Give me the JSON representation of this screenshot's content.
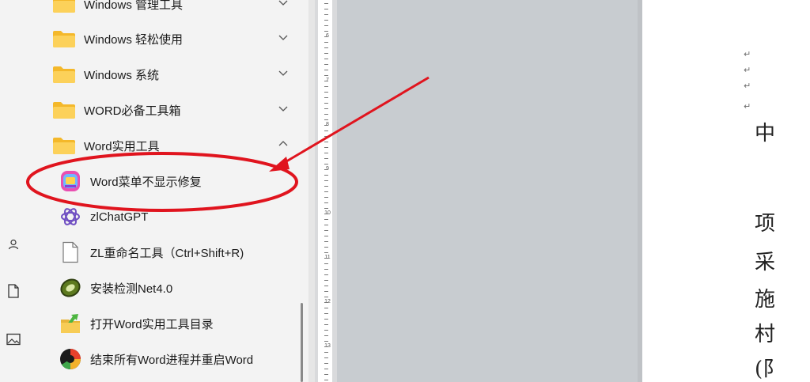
{
  "start_menu": {
    "items": [
      {
        "label": "Windows 管理工具",
        "type": "folder",
        "expanded": false
      },
      {
        "label": "Windows 轻松使用",
        "type": "folder",
        "expanded": false
      },
      {
        "label": "Windows 系统",
        "type": "folder",
        "expanded": false
      },
      {
        "label": "WORD必备工具箱",
        "type": "folder",
        "expanded": false
      },
      {
        "label": "Word实用工具",
        "type": "folder",
        "expanded": true
      }
    ],
    "sub_items": [
      {
        "label": "Word菜单不显示修复",
        "icon": "repair-app-icon"
      },
      {
        "label": "zlChatGPT",
        "icon": "chatgpt-icon"
      },
      {
        "label": "ZL重命名工具（Ctrl+Shift+R)",
        "icon": "blank-document-icon"
      },
      {
        "label": "安装检测Net4.0",
        "icon": "net-install-icon"
      },
      {
        "label": "打开Word实用工具目录",
        "icon": "folder-arrow-icon"
      },
      {
        "label": "结束所有Word进程并重启Word",
        "icon": "restart-word-icon"
      }
    ],
    "rail_icons": [
      "user-icon",
      "document-icon",
      "pictures-icon"
    ]
  },
  "ruler": {
    "numbers": [
      "6",
      "7",
      "8",
      "9",
      "10",
      "11",
      "12",
      "13"
    ]
  },
  "document": {
    "chars": [
      "中",
      "项",
      "采",
      "施",
      "村",
      "(阝"
    ]
  },
  "annotation": {
    "highlight_color": "#e0141e",
    "arrow_color": "#e0141e"
  }
}
